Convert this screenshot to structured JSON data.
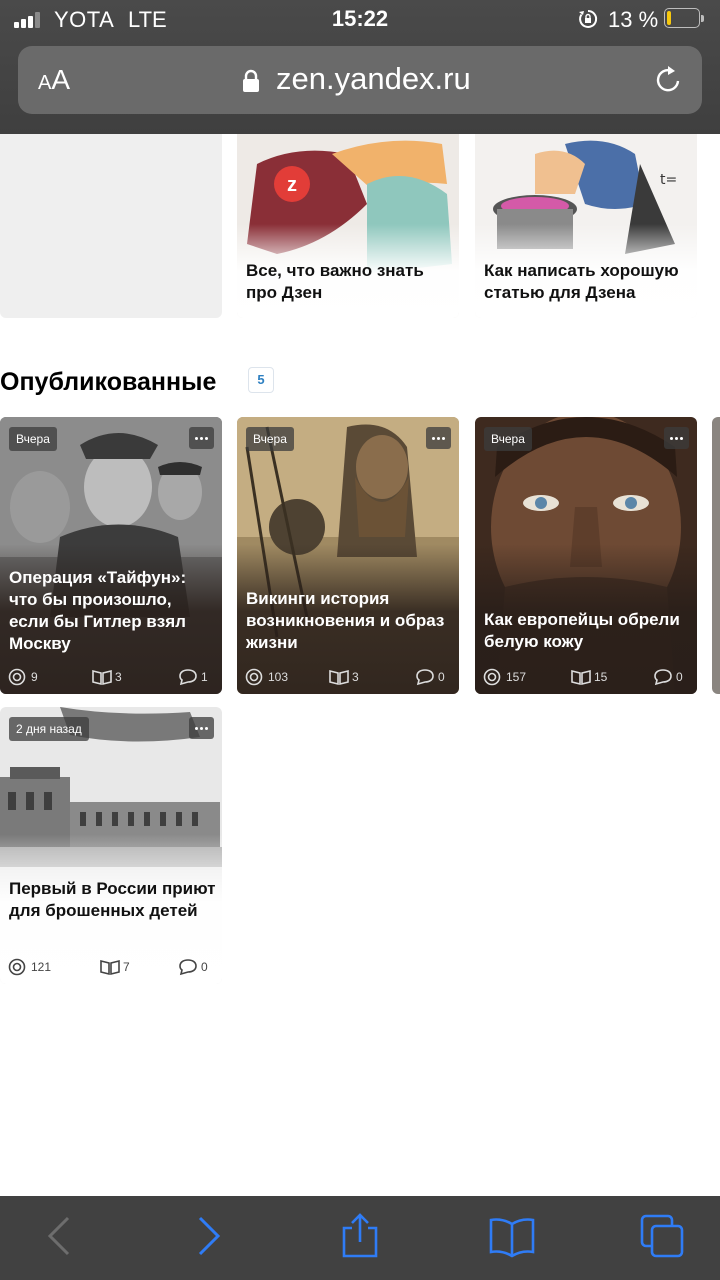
{
  "status": {
    "carrier": "YOTA",
    "network": "LTE",
    "time": "15:22",
    "battery": "13 %",
    "battery_level": 0.13,
    "battery_color": "#f6c80e"
  },
  "browser": {
    "text_size_small": "A",
    "text_size_big": "A",
    "url": "zen.yandex.ru"
  },
  "top_cards": [
    {
      "title": "Все, что важно знать про Дзен",
      "image": "zen-mascot-illustration"
    },
    {
      "title": "Как написать хорошую статью для Дзена",
      "image": "cooking-article-illustration"
    }
  ],
  "published": {
    "title": "Опубликованные",
    "count": "5",
    "count_color": "#2d7fc1",
    "articles": [
      {
        "badge": "Вчера",
        "title": "Операция «Тайфун»: что бы произошло, если бы Гитлер взял Москву",
        "views": "9",
        "reads": "3",
        "comments": "1",
        "image": "ww2-officers-photo"
      },
      {
        "badge": "Вчера",
        "title": "Викинги история возникновения и образ жизни",
        "views": "103",
        "reads": "3",
        "comments": "0",
        "image": "viking-warrior-painting"
      },
      {
        "badge": "Вчера",
        "title": "Как европейцы обрели белую кожу",
        "views": "157",
        "reads": "15",
        "comments": "0",
        "image": "ancient-man-portrait"
      },
      {
        "badge": "2 дня назад",
        "title": "Первый в России приют для брошенных детей",
        "views": "121",
        "reads": "7",
        "comments": "0",
        "image": "old-building-photo"
      }
    ]
  },
  "toolbar": {
    "icons": [
      "back-icon",
      "forward-icon",
      "share-icon",
      "bookmarks-icon",
      "tabs-icon"
    ],
    "accent": "#2f7cf6"
  }
}
